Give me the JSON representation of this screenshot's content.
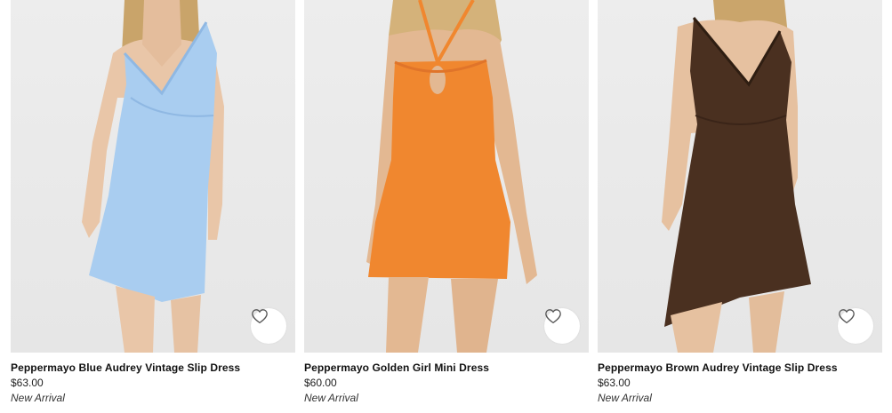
{
  "products": [
    {
      "name": "Peppermayo Blue Audrey Vintage Slip Dress",
      "price": "$63.00",
      "badge": "New Arrival",
      "dress_color": "#a9cdf0",
      "icon": "heart-outline-icon"
    },
    {
      "name": "Peppermayo Golden Girl Mini Dress",
      "price": "$60.00",
      "badge": "New Arrival",
      "dress_color": "#f0872f",
      "icon": "heart-outline-icon"
    },
    {
      "name": "Peppermayo Brown Audrey Vintage Slip Dress",
      "price": "$63.00",
      "badge": "New Arrival",
      "dress_color": "#4a3020",
      "icon": "heart-outline-icon"
    }
  ]
}
